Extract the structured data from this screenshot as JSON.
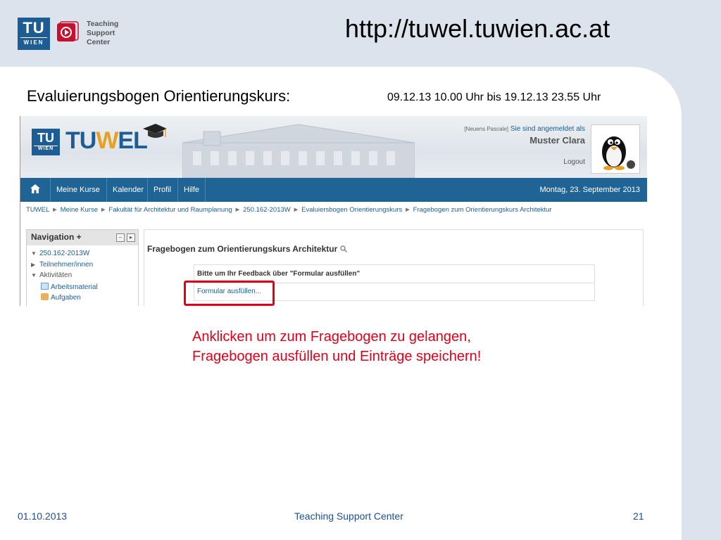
{
  "slide": {
    "url": "http://tuwel.tuwien.ac.at",
    "heading": "Evaluierungsbogen Orientierungskurs:",
    "dates": "09.12.13  10.00 Uhr bis 19.12.13  23.55 Uhr",
    "annotation_line1": "Anklicken um zum Fragebogen zu gelangen,",
    "annotation_line2": "Fragebogen ausfüllen und Einträge speichern!",
    "logo": {
      "tu": "TU",
      "wien": "WIEN",
      "tsc_lines": [
        "Teaching",
        "Support",
        "Center"
      ]
    },
    "footer": {
      "date": "01.10.2013",
      "center": "Teaching Support Center",
      "page": "21"
    },
    "highlight_color": "#e0001a"
  },
  "tuwel": {
    "logo_prefix": "TU",
    "logo_w": "W",
    "logo_suffix": "EL",
    "mini_tu": "TU",
    "mini_wien": "WIEN",
    "login_badge": "[Neuens Pascale]",
    "login_text": "Sie sind angemeldet als",
    "login_name": "Muster Clara",
    "logout": "Logout",
    "nav": [
      "Meine Kurse",
      "Kalender",
      "Profil",
      "Hilfe"
    ],
    "date": "Montag, 23. September 2013",
    "breadcrumb": [
      "TUWEL",
      "Meine Kurse",
      "Fakultät für Architektur und Raumplanung",
      "250.162-2013W",
      "Evaluiersbogen Orientierungskurs",
      "Fragebogen zum Orientierungskurs Architektur"
    ],
    "navblock": {
      "title": "Navigation +",
      "items": [
        "250.162-2013W",
        "Teilnehmer/innen",
        "Aktivitäten",
        "Arbeitsmaterial",
        "Aufgaben"
      ]
    },
    "page_title": "Fragebogen zum Orientierungskurs Architektur",
    "feedback_title": "Bitte um Ihr Feedback über \"Formular ausfüllen\"",
    "feedback_link": "Formular ausfüllen...",
    "colors": {
      "navbar": "#1f6494",
      "brand": "#1d5d94",
      "accent": "#e8a020"
    }
  }
}
